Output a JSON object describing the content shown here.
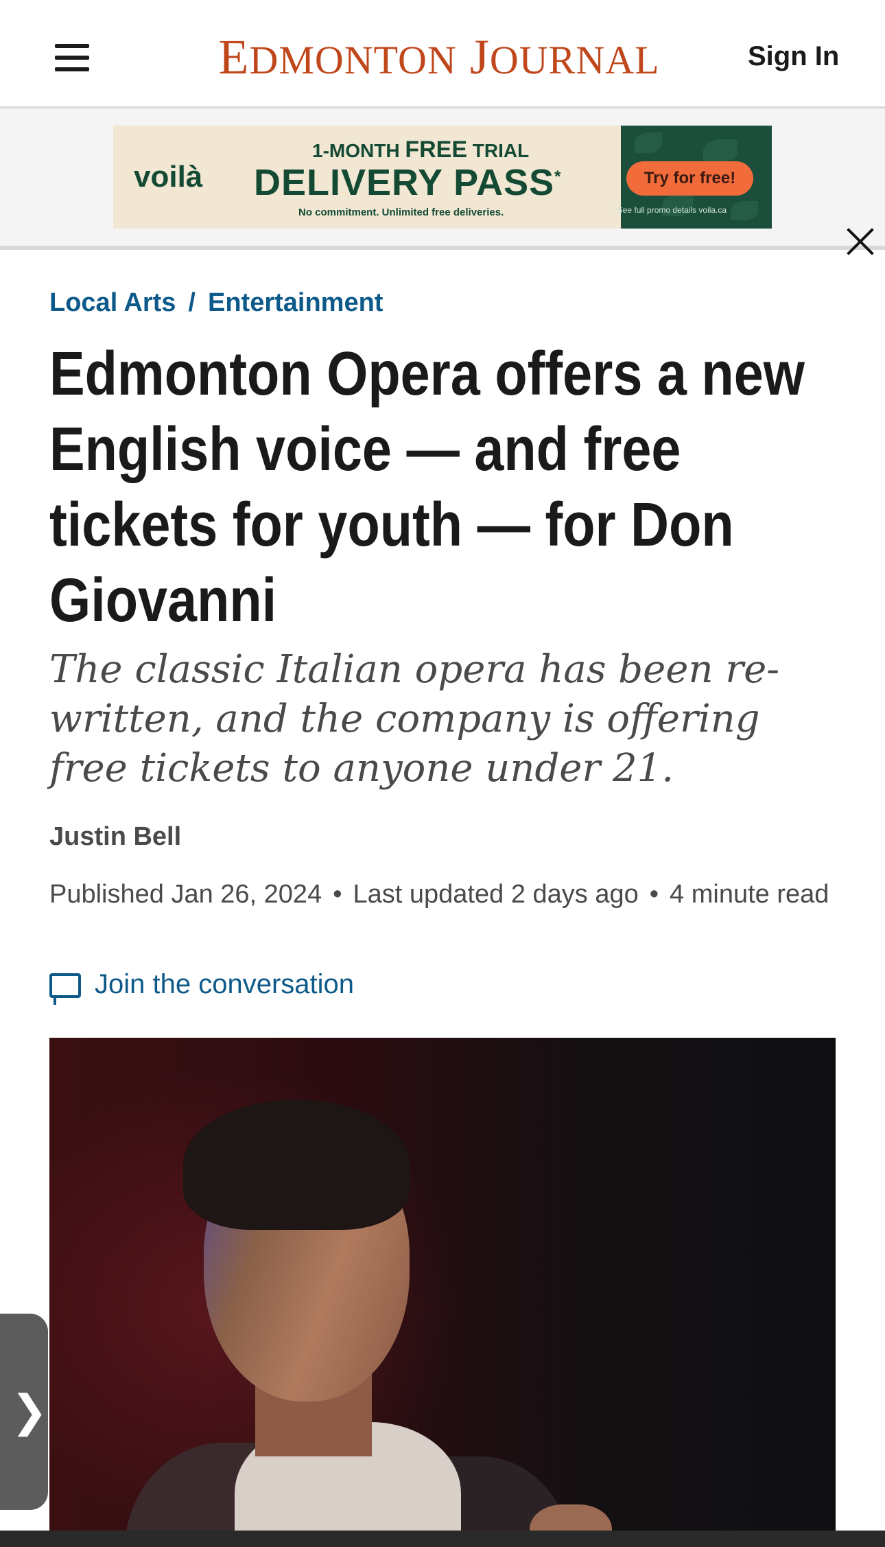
{
  "header": {
    "menu_icon": "hamburger-menu-icon",
    "logo": {
      "word1_initial": "E",
      "word1_rest": "DMONTON",
      "word2_initial": "J",
      "word2_rest": "OURNAL",
      "color": "#c0461b"
    },
    "signin_label": "Sign In"
  },
  "ad": {
    "brand": "voilà",
    "top_line_prefix": "1-MONTH ",
    "top_line_bold": "FREE",
    "top_line_suffix": " TRIAL",
    "headline": "DELIVERY PASS",
    "headline_mark": "*",
    "subline": "No commitment. Unlimited free deliveries.",
    "cta": "Try for free!",
    "fine_print": "*See full promo details voila.ca",
    "close_icon": "close-icon"
  },
  "article": {
    "breadcrumb": [
      "Local Arts",
      "Entertainment"
    ],
    "breadcrumb_separator": "/",
    "headline": "Edmonton Opera offers a new English voice — and free tickets for youth — for Don Giovanni",
    "deck": "The classic Italian opera has been re-written, and the company is offering free tickets to anyone under 21.",
    "author": "Justin Bell",
    "published": "Published Jan 26, 2024",
    "updated": "Last updated 2 days ago",
    "read_time": "4 minute read",
    "meta_separator": "•",
    "conversation_label": "Join the conversation",
    "conversation_icon": "comment-icon"
  },
  "sidetab": {
    "glyph": "❯"
  },
  "colors": {
    "accent_blue": "#0d5a8a",
    "brand_orange": "#c0461b",
    "text": "#1a1a1a",
    "muted": "#4a4a4a"
  }
}
